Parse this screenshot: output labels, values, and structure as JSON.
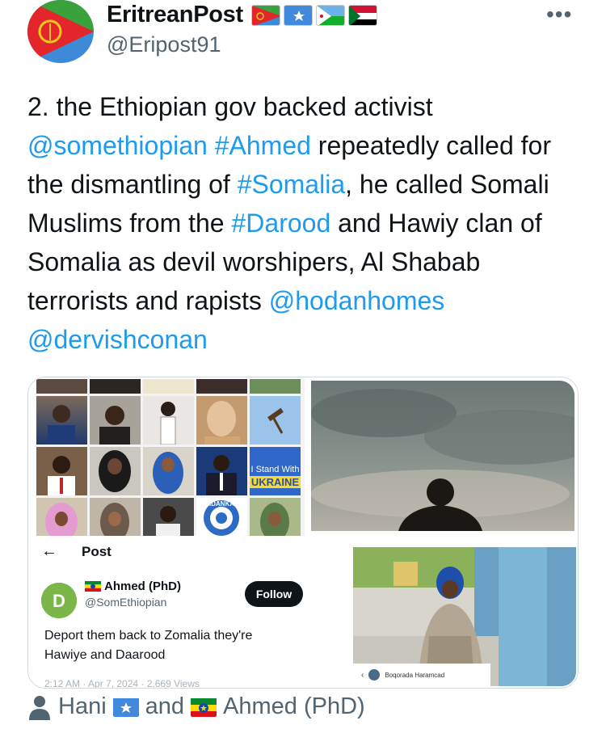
{
  "header": {
    "display_name": "EritreanPost",
    "username": "@Eripost91",
    "more_label": "•••",
    "flag_icons": [
      "eritrea-flag-icon",
      "somalia-flag-icon",
      "djibouti-flag-icon",
      "sudan-flag-icon"
    ]
  },
  "tweet": {
    "segments": [
      {
        "text": "2.  the  Ethiopian gov backed activist ",
        "link": false
      },
      {
        "text": "@somethiopian",
        "link": true
      },
      {
        "text": " ",
        "link": false
      },
      {
        "text": "#Ahmed",
        "link": true
      },
      {
        "text": " repeatedly called for the dismantling of ",
        "link": false
      },
      {
        "text": "#Somalia",
        "link": true
      },
      {
        "text": ", he called Somali Muslims from the ",
        "link": false
      },
      {
        "text": "#Darood",
        "link": true
      },
      {
        "text": " and Hawiy clan of Somalia as devil worshipers, Al Shabab terrorists and rapists ",
        "link": false
      },
      {
        "text": "@hodanhomes",
        "link": true
      },
      {
        "text": " ",
        "link": false
      },
      {
        "text": "@dervishconan",
        "link": true
      }
    ]
  },
  "media": {
    "collage": {
      "ukraine_top": "I Stand With",
      "ukraine_bottom": "UKRAINE",
      "seal_text": "CIIDANKA"
    },
    "embed": {
      "back_icon": "←",
      "title": "Post",
      "name": "Ahmed (PhD)",
      "handle": "@SomEthiopian",
      "follow_label": "Follow",
      "text": "Deport them back to Zomalia they're Hawiye and Daarood",
      "time": "2:12 AM · Apr 7, 2024 · 2,669 Views"
    },
    "soldier_caption": "Boqorada Haramcad"
  },
  "footer": {
    "name1": "Hani",
    "and": "and",
    "name2": "Ahmed (PhD)"
  },
  "colors": {
    "link": "#1d9bf0",
    "text": "#0f1419",
    "muted": "#536471"
  }
}
